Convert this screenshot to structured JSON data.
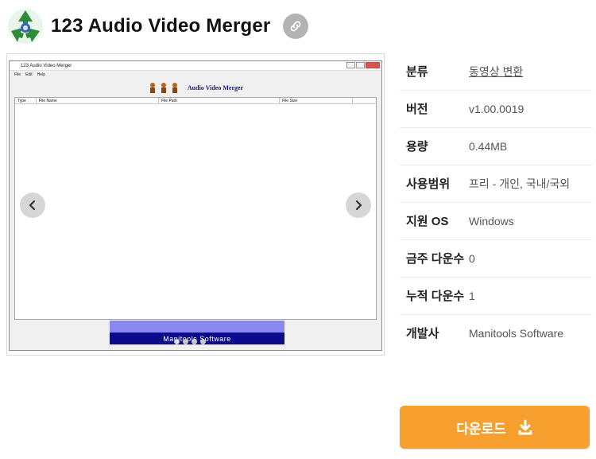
{
  "header": {
    "title": "123 Audio Video Merger",
    "logo_icon": "recycle-logo-icon",
    "link_icon": "link-icon"
  },
  "gallery": {
    "prev_icon": "chevron-left-icon",
    "next_icon": "chevron-right-icon",
    "dot_count": 4,
    "active_dot": 0,
    "screenshot": {
      "window_title": "123 Audio Video Merger",
      "menu": [
        "File",
        "Edit",
        "Help"
      ],
      "brand": "Audio Video Merger",
      "columns": [
        "Type",
        "File Name",
        "File Path",
        "File Size"
      ],
      "banner": "Manitools Software"
    }
  },
  "info": [
    {
      "label": "분류",
      "value": "동영상 변환",
      "link": true
    },
    {
      "label": "버전",
      "value": "v1.00.0019"
    },
    {
      "label": "용량",
      "value": "0.44MB"
    },
    {
      "label": "사용범위",
      "value": "프리 - 개인, 국내/국외"
    },
    {
      "label": "지원 OS",
      "value": "Windows"
    },
    {
      "label": "금주 다운수",
      "value": "0"
    },
    {
      "label": "누적 다운수",
      "value": "1"
    },
    {
      "label": "개발사",
      "value": "Manitools Software"
    }
  ],
  "download": {
    "label": "다운로드",
    "icon": "download-icon"
  },
  "colors": {
    "accent": "#f7a030",
    "link_button": "#b3b3b3",
    "banner_dark": "#0a0a8a",
    "banner_light": "#8888ee"
  }
}
